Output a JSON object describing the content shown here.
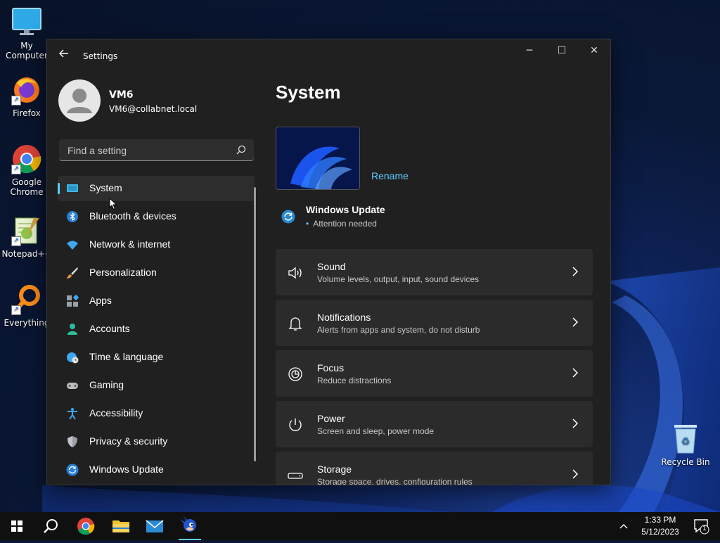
{
  "desktop": {
    "icons": [
      {
        "label": "My Computer",
        "icon": "monitor-icon"
      },
      {
        "label": "Firefox",
        "icon": "firefox-icon"
      },
      {
        "label": "Google Chrome",
        "icon": "chrome-icon"
      },
      {
        "label": "Notepad++",
        "icon": "notepadpp-icon"
      },
      {
        "label": "Everything",
        "icon": "everything-icon"
      },
      {
        "label": "Recycle Bin",
        "icon": "recycle-bin-icon"
      }
    ]
  },
  "window": {
    "title": "Settings",
    "controls": {
      "minimize": "─",
      "maximize": "☐",
      "close": "✕"
    },
    "profile": {
      "name": "VM6",
      "email": "VM6@collabnet.local"
    },
    "search": {
      "placeholder": "Find a setting"
    },
    "nav": [
      {
        "label": "System",
        "icon": "system-icon",
        "active": true
      },
      {
        "label": "Bluetooth & devices",
        "icon": "bluetooth-icon"
      },
      {
        "label": "Network & internet",
        "icon": "wifi-icon"
      },
      {
        "label": "Personalization",
        "icon": "brush-icon"
      },
      {
        "label": "Apps",
        "icon": "apps-icon"
      },
      {
        "label": "Accounts",
        "icon": "accounts-icon"
      },
      {
        "label": "Time & language",
        "icon": "globe-clock-icon"
      },
      {
        "label": "Gaming",
        "icon": "gamepad-icon"
      },
      {
        "label": "Accessibility",
        "icon": "accessibility-icon"
      },
      {
        "label": "Privacy & security",
        "icon": "shield-icon"
      },
      {
        "label": "Windows Update",
        "icon": "update-icon"
      }
    ],
    "main": {
      "heading": "System",
      "rename_label": "Rename",
      "windows_update": {
        "title": "Windows Update",
        "status": "Attention needed"
      },
      "cards": [
        {
          "title": "Sound",
          "subtitle": "Volume levels, output, input, sound devices",
          "icon": "speaker-icon"
        },
        {
          "title": "Notifications",
          "subtitle": "Alerts from apps and system, do not disturb",
          "icon": "bell-icon"
        },
        {
          "title": "Focus",
          "subtitle": "Reduce distractions",
          "icon": "focus-icon"
        },
        {
          "title": "Power",
          "subtitle": "Screen and sleep, power mode",
          "icon": "power-icon"
        },
        {
          "title": "Storage",
          "subtitle": "Storage space, drives, configuration rules",
          "icon": "storage-icon"
        }
      ]
    }
  },
  "taskbar": {
    "time": "1:33 PM",
    "date": "5/12/2023",
    "notification_count": "1",
    "accent": "#60cdff"
  }
}
